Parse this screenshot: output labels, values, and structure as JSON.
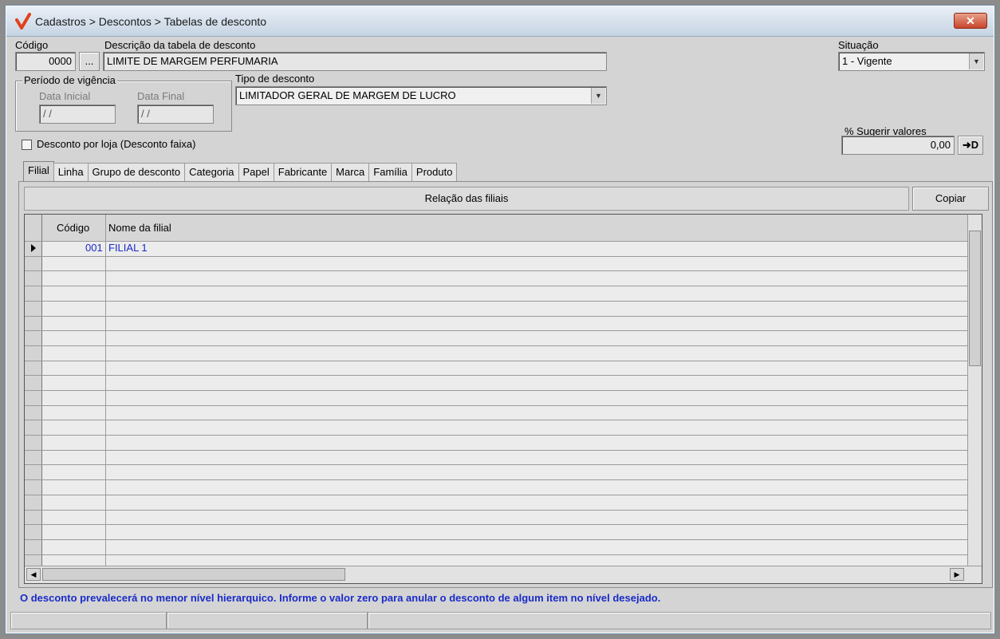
{
  "window": {
    "title": "Cadastros > Descontos > Tabelas de desconto",
    "close_label": "✕"
  },
  "form": {
    "codigo_label": "Código",
    "codigo_value": "0000",
    "lookup_label": "...",
    "descricao_label": "Descrição da tabela de desconto",
    "descricao_value": "LIMITE DE MARGEM PERFUMARIA",
    "situacao_label": "Situação",
    "situacao_value": "1 - Vigente",
    "periodo_label": "Período de vigência",
    "data_inicial_label": "Data Inicial",
    "data_inicial_value": "/ /",
    "data_final_label": "Data Final",
    "data_final_value": "/ /",
    "tipo_label": "Tipo de desconto",
    "tipo_value": "LIMITADOR GERAL DE MARGEM DE LUCRO",
    "desconto_loja_label": "Desconto por loja (Desconto faixa)",
    "desconto_loja_checked": false,
    "sugerir_label": "% Sugerir valores",
    "sugerir_value": "0,00",
    "sugerir_btn": "➜D"
  },
  "tabs": [
    {
      "label": "Filial",
      "active": true
    },
    {
      "label": "Linha"
    },
    {
      "label": "Grupo de desconto"
    },
    {
      "label": "Categoria"
    },
    {
      "label": "Papel"
    },
    {
      "label": "Fabricante"
    },
    {
      "label": "Marca"
    },
    {
      "label": "Família"
    },
    {
      "label": "Produto"
    }
  ],
  "panel": {
    "header": "Relação das filiais",
    "copy_label": "Copiar"
  },
  "grid": {
    "columns": [
      "Código",
      "Nome da filial"
    ],
    "rows": [
      {
        "codigo": "001",
        "nome": "FILIAL 1"
      }
    ]
  },
  "footnote": "O desconto prevalecerá no menor nível hierarquico. Informe o valor zero para anular o desconto de algum item no nível desejado.",
  "colors": {
    "accent_text": "#1a2bc8",
    "logo": "#e2401c"
  }
}
